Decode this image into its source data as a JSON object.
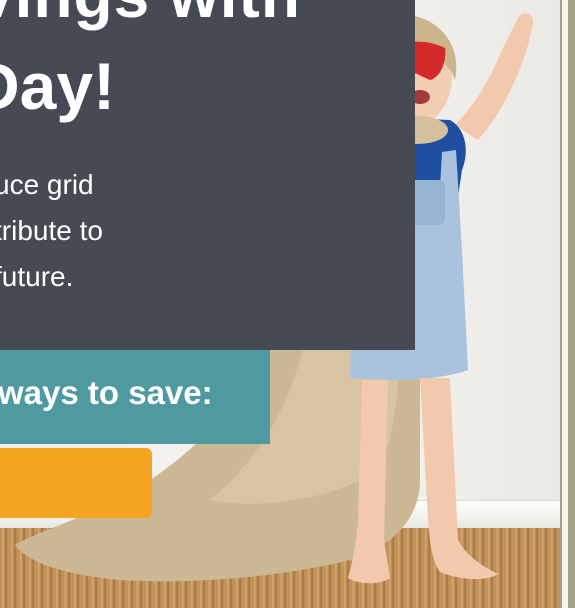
{
  "hero": {
    "headline_line1": "vings with",
    "headline_line2": "Day!",
    "body_lines": [
      "uce grid",
      "tribute to",
      "future."
    ],
    "ways_label": "ways to save:"
  },
  "cta": {
    "label": ""
  },
  "colors": {
    "panel": "#454a54",
    "teal": "#4f9aa1",
    "orange": "#f6a523",
    "text": "#ffffff"
  }
}
